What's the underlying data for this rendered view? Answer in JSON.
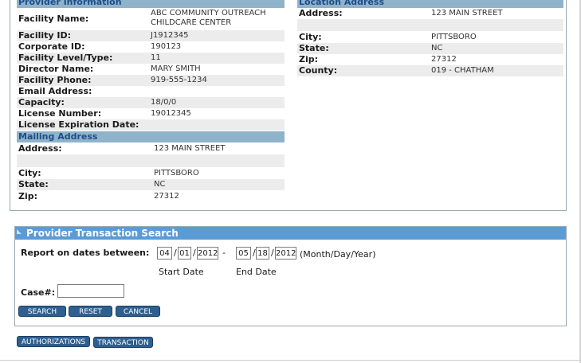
{
  "provider_info": {
    "title": "Provider Information",
    "fields": [
      {
        "label": "Facility Name:",
        "value": "ABC COMMUNITY OUTREACH\nCHILDCARE CENTER"
      },
      {
        "label": "Facility ID:",
        "value": "J1912345"
      },
      {
        "label": "Corporate ID:",
        "value": "190123"
      },
      {
        "label": "Facility Level/Type:",
        "value": "11"
      },
      {
        "label": "Director Name:",
        "value": "MARY SMITH"
      },
      {
        "label": "Facility Phone:",
        "value": "919-555-1234"
      },
      {
        "label": "Email Address:",
        "value": ""
      },
      {
        "label": "Capacity:",
        "value": "18/0/0"
      },
      {
        "label": "License Number:",
        "value": "19012345"
      },
      {
        "label": "License Expiration Date:",
        "value": ""
      }
    ]
  },
  "mailing_address": {
    "title": "Mailing Address",
    "fields": [
      {
        "label": "Address:",
        "value": "123 MAIN STREET"
      },
      {
        "label": "",
        "value": ""
      },
      {
        "label": "City:",
        "value": "PITTSBORO"
      },
      {
        "label": "State:",
        "value": "NC"
      },
      {
        "label": "Zip:",
        "value": "27312"
      }
    ]
  },
  "location_address": {
    "title": "Location Address",
    "fields": [
      {
        "label": "Address:",
        "value": "123 MAIN STREET"
      },
      {
        "label": "",
        "value": ""
      },
      {
        "label": "City:",
        "value": "PITTSBORO"
      },
      {
        "label": "State:",
        "value": "NC"
      },
      {
        "label": "Zip:",
        "value": "27312"
      },
      {
        "label": "County:",
        "value": "019 - CHATHAM"
      }
    ]
  },
  "search": {
    "title": "Provider Transaction Search",
    "dates_label": "Report on dates between:",
    "start": {
      "month": "04",
      "day": "01",
      "year": "2012"
    },
    "end": {
      "month": "05",
      "day": "18",
      "year": "2012"
    },
    "date_dash": "-",
    "date_slash": "/",
    "format_hint": "(Month/Day/Year)",
    "start_caption": "Start Date",
    "end_caption": "End Date",
    "case_label": "Case#:",
    "case_value": "",
    "buttons": {
      "search": "SEARCH",
      "reset": "RESET",
      "cancel": "CANCEL"
    }
  },
  "bottom_buttons": {
    "authorizations": "AUTHORIZATIONS",
    "transaction": "TRANSACTION"
  }
}
